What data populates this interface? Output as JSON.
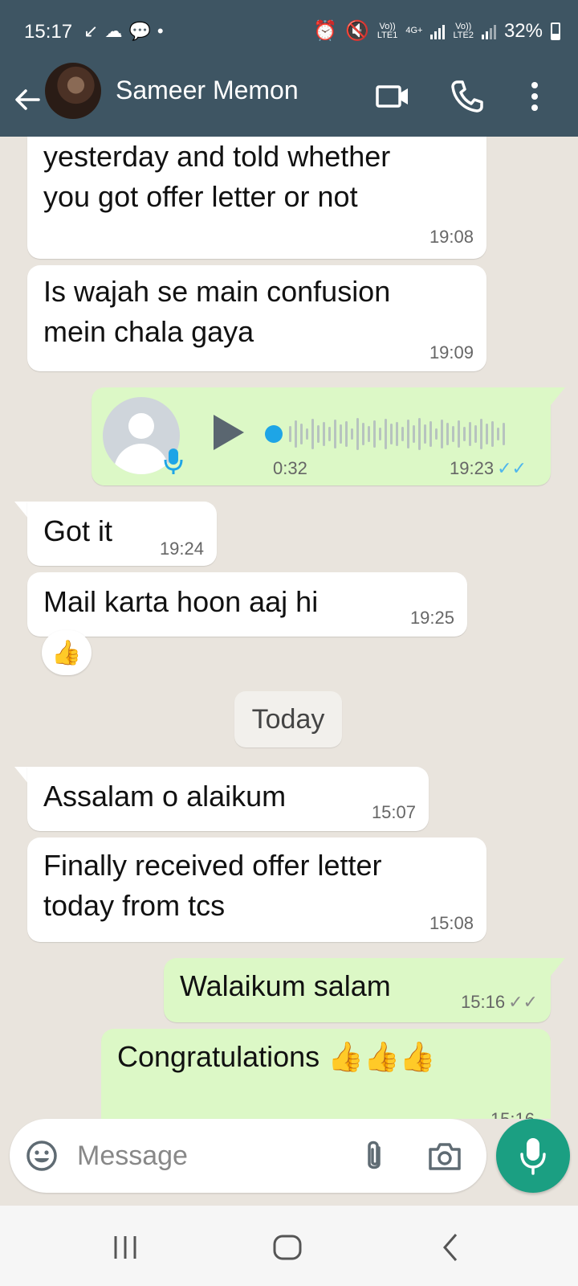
{
  "status_bar": {
    "time": "15:17",
    "network1_top": "Vo))",
    "network1_bottom": "LTE1",
    "network_type": "4G+",
    "network2_top": "Vo))",
    "network2_bottom": "LTE2",
    "battery": "32%"
  },
  "header": {
    "contact_name": "Sameer Memon",
    "icons": [
      "back-arrow-icon",
      "video-call-icon",
      "phone-icon",
      "more-vert-icon"
    ],
    "color": "#3e5563"
  },
  "messages": [
    {
      "direction": "in",
      "text_lines": [
        "yesterday and told whether",
        "you got offer letter or not"
      ],
      "time": "19:08"
    },
    {
      "direction": "in",
      "text_lines": [
        "Is wajah se main confusion",
        "mein chala gaya"
      ],
      "time": "19:09"
    },
    {
      "direction": "out",
      "type": "voice",
      "duration": "0:32",
      "time": "19:23",
      "ticks": "✓✓",
      "ticks_color": "#4fb6ec"
    },
    {
      "direction": "in",
      "text_lines": [
        "Got it"
      ],
      "time": "19:24"
    },
    {
      "direction": "in",
      "text_lines": [
        "Mail karta hoon aaj hi"
      ],
      "time": "19:25",
      "reaction": "👍"
    },
    {
      "direction": "in",
      "text_lines": [
        "Assalam o alaikum"
      ],
      "time": "15:07"
    },
    {
      "direction": "in",
      "text_lines": [
        "Finally received offer letter",
        "today from tcs"
      ],
      "time": "15:08"
    },
    {
      "direction": "out",
      "text_lines": [
        "Walaikum salam"
      ],
      "time": "15:16",
      "ticks": "✓✓",
      "ticks_color": "#8a8a8a"
    },
    {
      "direction": "out",
      "text_lines": [
        "Congratulations 👍👍👍"
      ],
      "time": "15:16"
    }
  ],
  "day_separator": "Today",
  "composer": {
    "placeholder": "Message",
    "icons": [
      "emoji-icon",
      "attach-icon",
      "camera-icon",
      "mic-icon"
    ],
    "accent": "#1b9f82"
  },
  "colors": {
    "chat_bg": "#e9e4dd",
    "outgoing_bubble": "#dcf8c6",
    "incoming_bubble": "#ffffff"
  }
}
